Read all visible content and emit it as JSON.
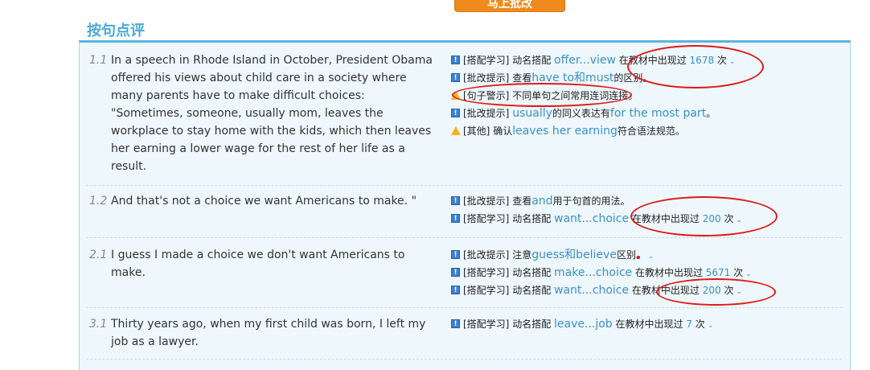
{
  "top_button": {
    "label": "马上批改"
  },
  "section_title": "按句点评",
  "rows": [
    {
      "num": "1.1",
      "text": "In a speech in Rhode Island in October, President Obama offered his views about child care in a society where many parents have to make difficult choices: \"Sometimes, someone, usually mom, leaves the workplace to stay home with the kids, which then leaves her earning a lower wage for the rest of her life as a result.",
      "tips": [
        {
          "icon": "info",
          "tag": "[搭配学习]",
          "pre": " 动名搭配 ",
          "hl": "offer...view",
          "post": " 在教材中出现过 ",
          "count": "1678",
          "unit": " 次",
          "chev": "⌄"
        },
        {
          "icon": "info",
          "tag": "[批改提示]",
          "pre": " 查看",
          "hl": "have to和must",
          "post": "的区别。",
          "count": "",
          "unit": "",
          "chev": ""
        },
        {
          "icon": "warn",
          "tag": "[句子警示]",
          "pre": " 不同单句之间常用连词连接。",
          "hl": "",
          "post": "",
          "count": "",
          "unit": "",
          "chev": ""
        },
        {
          "icon": "info",
          "tag": "[批改提示]",
          "pre": " ",
          "hl": "usually",
          "post": "的同义表达有",
          "hl2": "for the most part",
          "post2": "。",
          "count": "",
          "unit": "",
          "chev": ""
        },
        {
          "icon": "warn",
          "tag": "[其他]",
          "pre": " 确认",
          "hl": "leaves her earning",
          "post": "符合语法规范。",
          "count": "",
          "unit": "",
          "chev": ""
        }
      ]
    },
    {
      "num": "1.2",
      "text": "And that's not a choice we want Americans to make. \"",
      "tips": [
        {
          "icon": "info",
          "tag": "[批改提示]",
          "pre": " 查看",
          "hl": "and",
          "post": "用于句首的用法。",
          "count": "",
          "unit": "",
          "chev": ""
        },
        {
          "icon": "info",
          "tag": "[搭配学习]",
          "pre": " 动名搭配 ",
          "hl": "want...choice",
          "post": " 在教材中出现过 ",
          "count": "200",
          "unit": " 次",
          "chev": "⌄"
        }
      ]
    },
    {
      "num": "2.1",
      "text": "I guess I made a choice we don't want Americans to make.",
      "tips": [
        {
          "icon": "info",
          "tag": "[批改提示]",
          "pre": " 注意",
          "hl": "guess和believe",
          "post": "区别。",
          "count": "",
          "unit": "",
          "chev": "⌄"
        },
        {
          "icon": "info",
          "tag": "[搭配学习]",
          "pre": " 动名搭配 ",
          "hl": "make...choice",
          "post": " 在教材中出现过 ",
          "count": "5671",
          "unit": " 次",
          "chev": "⌄"
        },
        {
          "icon": "info",
          "tag": "[搭配学习]",
          "pre": " 动名搭配 ",
          "hl": "want...choice",
          "post": " 在教材中出现过 ",
          "count": "200",
          "unit": " 次",
          "chev": "⌄"
        }
      ]
    },
    {
      "num": "3.1",
      "text": "Thirty years ago, when my first child was born, I left my job as a lawyer.",
      "tips": [
        {
          "icon": "info",
          "tag": "[搭配学习]",
          "pre": " 动名搭配 ",
          "hl": "leave...job",
          "post": " 在教材中出现过 ",
          "count": "7",
          "unit": " 次",
          "chev": "⌄"
        }
      ]
    }
  ]
}
